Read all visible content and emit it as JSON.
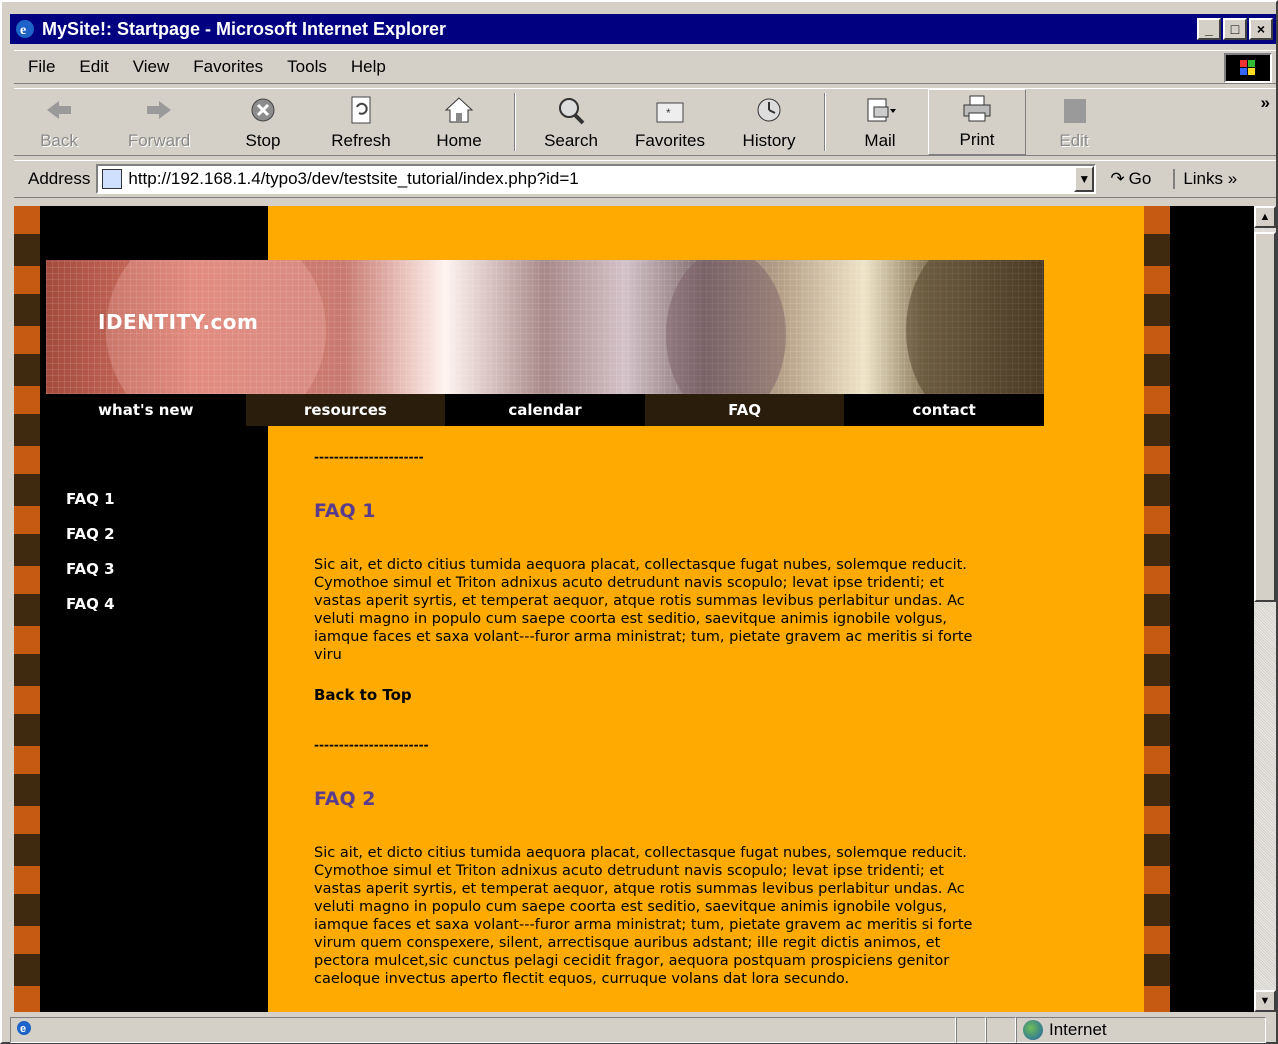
{
  "window": {
    "title": "MySite!: Startpage - Microsoft Internet Explorer",
    "controls": [
      "_",
      "□",
      "×"
    ]
  },
  "menu": [
    "File",
    "Edit",
    "View",
    "Favorites",
    "Tools",
    "Help"
  ],
  "toolbar": {
    "back": "Back",
    "forward": "Forward",
    "stop": "Stop",
    "refresh": "Refresh",
    "home": "Home",
    "search": "Search",
    "favorites": "Favorites",
    "history": "History",
    "mail": "Mail",
    "print": "Print",
    "edit": "Edit",
    "more": "»"
  },
  "address": {
    "label": "Address",
    "url": "http://192.168.1.4/typo3/dev/testsite_tutorial/index.php?id=1",
    "go": "Go",
    "links": "Links"
  },
  "site": {
    "logo": "IDENTITY.com",
    "nav": [
      "what's new",
      "resources",
      "calendar",
      "FAQ",
      "contact"
    ],
    "sidebar": [
      "FAQ 1",
      "FAQ 2",
      "FAQ 3",
      "FAQ 4"
    ],
    "separator1": "----------------------",
    "separator2": "-----------------------",
    "faq1_title": "FAQ 1",
    "faq1_body": "Sic ait, et dicto citius tumida aequora placat, collectasque fugat nubes, solemque reducit. Cymothoe simul et Triton adnixus acuto detrudunt navis scopulo; levat ipse tridenti; et vastas aperit syrtis, et temperat aequor, atque rotis summas levibus perlabitur undas. Ac veluti magno in populo cum saepe coorta est seditio, saevitque animis ignobile volgus, iamque faces et saxa volant---furor arma ministrat; tum, pietate gravem ac meritis si forte viru",
    "back_to_top": "Back to Top",
    "faq2_title": "FAQ 2",
    "faq2_body": "Sic ait, et dicto citius tumida aequora placat, collectasque fugat nubes, solemque reducit. Cymothoe simul et Triton adnixus acuto detrudunt navis scopulo; levat ipse tridenti; et vastas aperit syrtis, et temperat aequor, atque rotis summas levibus perlabitur undas. Ac veluti magno in populo cum saepe coorta est seditio, saevitque animis ignobile volgus, iamque faces et saxa volant---furor arma ministrat; tum, pietate gravem ac meritis si forte virum quem conspexere, silent, arrectisque auribus adstant; ille regit dictis animos, et pectora mulcet,sic cunctus pelagi cecidit fragor, aequora postquam prospiciens genitor caeloque invectus aperto flectit equos, curruque volans dat lora secundo."
  },
  "status": {
    "zone": "Internet"
  },
  "colors": {
    "content_bg": "#ffaa00",
    "heading": "#5a3c8c",
    "titlebar": "#000080"
  }
}
